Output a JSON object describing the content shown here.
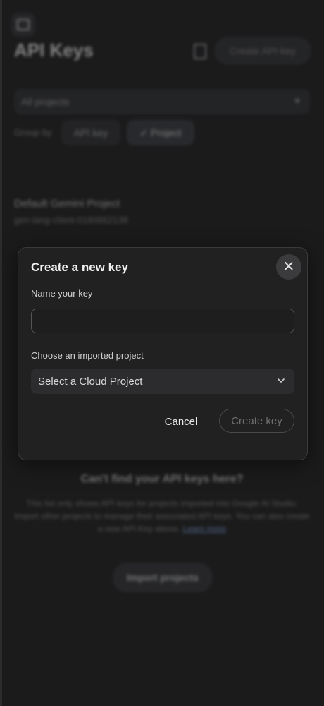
{
  "page": {
    "title": "API Keys",
    "create_button": "Create API key",
    "project_filter": "All projects",
    "group_by_label": "Group by",
    "group_options": [
      "API key",
      "Project"
    ],
    "project": {
      "name": "Default Gemini Project",
      "id": "gen-lang-client-0160662138"
    },
    "help": {
      "title": "Can't find your API keys here?",
      "text": "This list only shows API keys for projects imported into Google AI Studio. Import other projects to manage their associated API keys. You can also create a new API Key above.",
      "link": "Learn more"
    },
    "import_button": "Import projects"
  },
  "modal": {
    "title": "Create a new key",
    "name_label": "Name your key",
    "name_value": "",
    "project_label": "Choose an imported project",
    "project_select": "Select a Cloud Project",
    "cancel_label": "Cancel",
    "create_label": "Create key"
  },
  "colors": {
    "background": "#1b1b1c",
    "modal_background": "#212121",
    "disabled_text": "#6f6f6f"
  }
}
